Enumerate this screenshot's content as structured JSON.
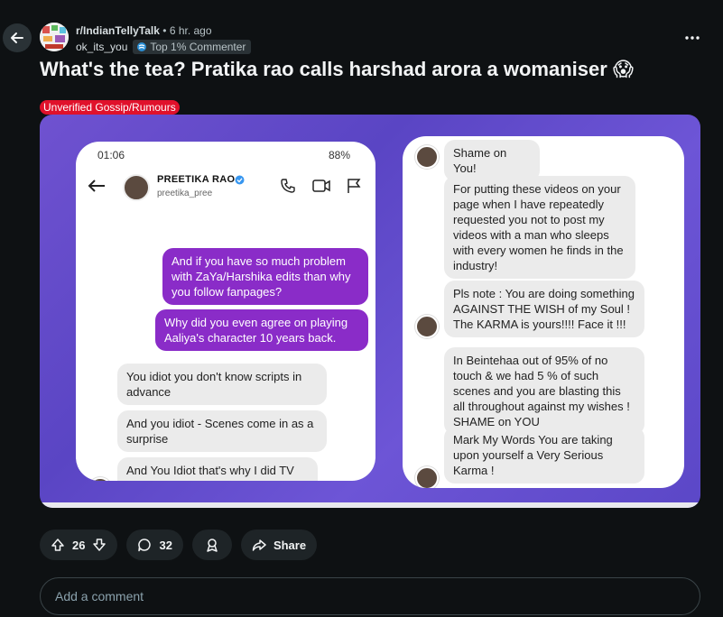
{
  "post": {
    "subreddit": "r/IndianTellyTalk",
    "separator": "•",
    "time": "6 hr. ago",
    "author": "ok_its_you",
    "author_badge": "Top 1% Commenter",
    "title": "What's the tea? Pratika rao calls harshad arora a womaniser",
    "title_emoji": "😱",
    "flair": "Unverified Gossip/Rumours"
  },
  "image": {
    "left_phone": {
      "status_time": "01:06",
      "status_battery": "88%",
      "contact_name": "PREETIKA RAO",
      "contact_handle": "preetika_pree",
      "messages": [
        "And if you have so much problem with ZaYa/Harshika edits than why you follow fanpages?",
        "Why did you even agree on playing Aaliya's character 10 years back.",
        "You idiot you don't know scripts in advance",
        "And you idiot - Scenes come in as a surprise",
        "And You Idiot that's why I did TV and not Bollywood!"
      ]
    },
    "right_phone": {
      "messages": [
        "Shame on You!",
        "For putting these videos on your page when I have repeatedly requested you not to post my videos with a man who sleeps with every women he finds in the industry!",
        "Pls note : You are doing something AGAINST THE WISH of my Soul ! The KARMA is yours!!!! Face it !!!",
        "In Beintehaa out of 95% of no touch & we had 5 % of such scenes and you are blasting this all throughout against my wishes ! SHAME on YOU",
        "Mark My Words You are taking upon yourself a Very Serious Karma !"
      ]
    }
  },
  "actions": {
    "upvotes": "26",
    "comments": "32",
    "share_label": "Share"
  },
  "comment_box": {
    "placeholder": "Add a comment"
  },
  "colors": {
    "background": "#0e1113",
    "flair": "#e0112b",
    "outgoing_bubble": "#8a2cc8",
    "image_background": "#6552cc"
  }
}
